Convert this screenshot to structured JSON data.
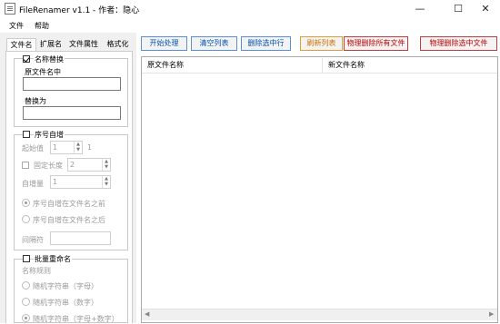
{
  "window": {
    "title": "FileRenamer v1.1 - 作者：隐心",
    "minimize": "—",
    "maximize": "☐",
    "close": "✕"
  },
  "menu": [
    "文件",
    "帮助"
  ],
  "tabs": [
    "文件名",
    "扩展名",
    "文件属性",
    "格式化"
  ],
  "active_tab": "文件名",
  "name_replace": {
    "checkbox_label": "名称替换",
    "checked": true,
    "original_label": "原文件名中",
    "original_value": "",
    "replace_label": "替换为",
    "replace_value": ""
  },
  "sequence": {
    "checkbox_label": "序号自增",
    "checked": false,
    "start_label": "起始值",
    "start_value": "1",
    "start_suffix": "1",
    "fixed_length_label": "固定长度",
    "fixed_length_value": "2",
    "increment_label": "自增量",
    "increment_value": "1",
    "position_options": [
      "序号自增在文件名之前",
      "序号自增在文件名之后"
    ],
    "selected_position": "序号自增在文件名之前",
    "separator_label": "间隔符",
    "separator_value": ""
  },
  "batch_rename": {
    "checkbox_label": "批量重命名",
    "checked": false,
    "rule_label": "名称规则",
    "options": [
      "随机字符串（字母）",
      "随机字符串（数字）",
      "随机字符串（字母+数字）"
    ],
    "selected": "随机字符串（字母+数字）"
  },
  "toolbar": {
    "start": "开始处理",
    "clear": "清空列表",
    "delete_selected_rows": "删除选中行",
    "refresh": "刷新列表",
    "physical_delete_all": "物理删除所有文件",
    "physical_delete_selected": "物理删除选中文件"
  },
  "table": {
    "columns": [
      "原文件名称",
      "新文件名称"
    ],
    "rows": []
  },
  "scroll_arrows": {
    "left": "◀",
    "right": "▶"
  }
}
